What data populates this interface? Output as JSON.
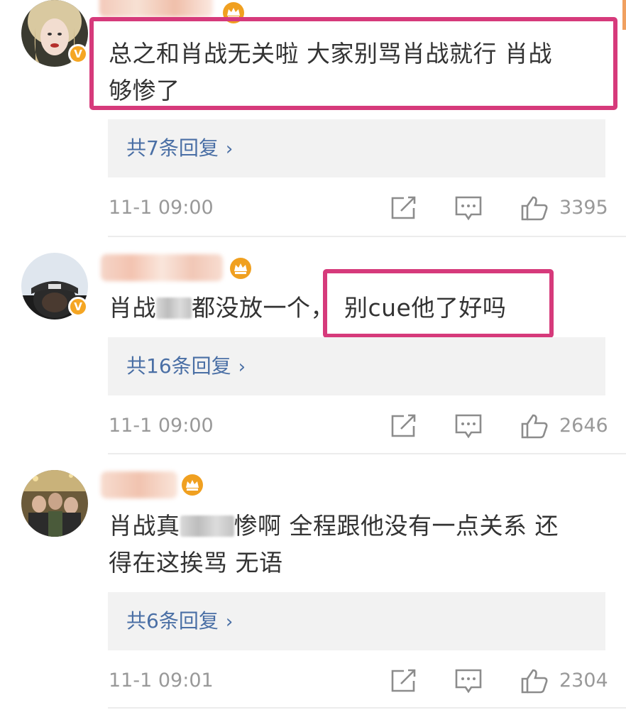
{
  "comments": [
    {
      "text_parts": [
        "总之和肖战无关啦 大家别骂肖战就行 肖战",
        "够惨了"
      ],
      "reply_label": "共7条回复",
      "timestamp": "11-1 09:00",
      "likes": "3395",
      "verified_badge": "V"
    },
    {
      "text_before": "肖战",
      "text_middle": "都没放一个，",
      "text_after": "别cue他了好吗",
      "reply_label": "共16条回复",
      "timestamp": "11-1 09:00",
      "likes": "2646",
      "verified_badge": "V"
    },
    {
      "text_before": "肖战真",
      "text_after": "惨啊 全程跟他没有一点关系 还",
      "text_line2": "得在这挨骂 无语",
      "reply_label": "共6条回复",
      "timestamp": "11-1 09:01",
      "likes": "2304"
    }
  ],
  "icons": {
    "share": "share-icon",
    "comment": "comment-icon",
    "like": "thumbs-up-icon",
    "crown": "crown-icon",
    "chevron": "chevron-right-icon"
  },
  "colors": {
    "highlight": "#d63a7b",
    "reply_link": "#4a6fa5",
    "badge": "#f5a623",
    "crown": "#f0a020"
  },
  "chevron_glyph": "›"
}
